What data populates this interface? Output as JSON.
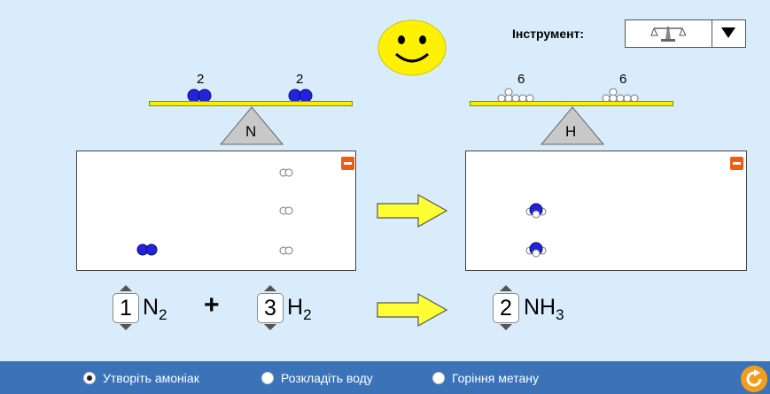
{
  "tool": {
    "label": "Інструмент:",
    "selected_icon": "balance-scale-icon"
  },
  "face": {
    "icon": "smiley-face-icon",
    "color": "#fff200"
  },
  "balances": [
    {
      "element": "N",
      "left_count": "2",
      "right_count": "2",
      "atom_color": "#1a1ad6"
    },
    {
      "element": "H",
      "left_count": "6",
      "right_count": "6",
      "atom_color": "#ffffff"
    }
  ],
  "reactants_box": {
    "molecules": [
      "N2",
      "H2",
      "H2",
      "H2"
    ]
  },
  "products_box": {
    "molecules": [
      "NH3",
      "NH3"
    ]
  },
  "equation": {
    "reactant1": {
      "coefficient": "1",
      "symbol": "N",
      "subscript": "2"
    },
    "plus": "+",
    "reactant2": {
      "coefficient": "3",
      "symbol": "H",
      "subscript": "2"
    },
    "product1": {
      "coefficient": "2",
      "symbol": "NH",
      "subscript": "3"
    }
  },
  "reactions": [
    {
      "label": "Утворіть амоніак",
      "selected": true
    },
    {
      "label": "Розкладіть воду",
      "selected": false
    },
    {
      "label": "Горіння метану",
      "selected": false
    }
  ],
  "colors": {
    "background": "#d8ecfb",
    "bar": "#3b73b9",
    "arrow": "#ffff33",
    "beam": "#f7f000",
    "minus": "#f25a0f",
    "reset": "#f39c1d"
  }
}
